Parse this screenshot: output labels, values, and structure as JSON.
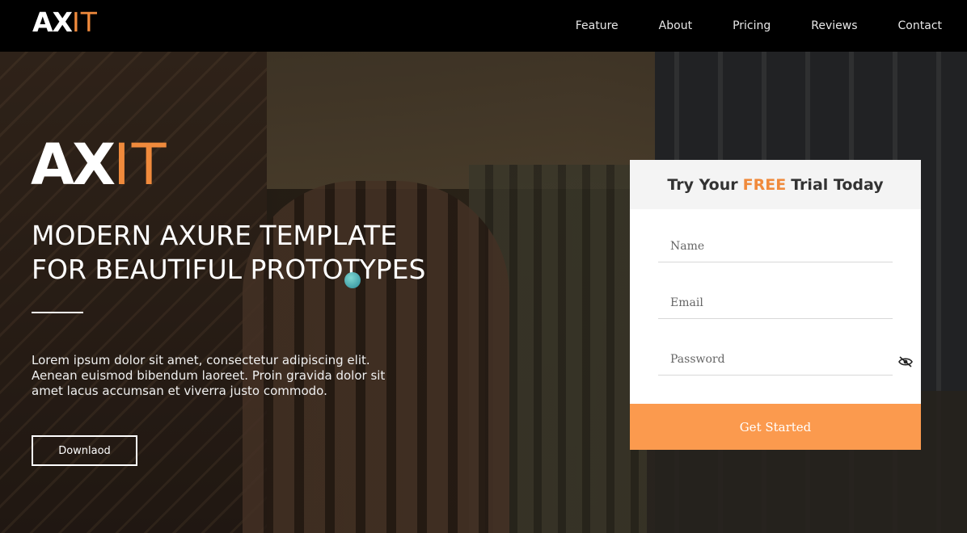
{
  "brand": {
    "ax": "AX",
    "it": "IT",
    "accent_color": "#f08a3c"
  },
  "nav": {
    "items": [
      {
        "label": "Feature"
      },
      {
        "label": "About"
      },
      {
        "label": "Pricing"
      },
      {
        "label": "Reviews"
      },
      {
        "label": "Contact"
      }
    ]
  },
  "hero": {
    "headline_line1": "MODERN AXURE TEMPLATE",
    "headline_line2": "FOR BEAUTIFUL PROTOTYPES",
    "description": "Lorem ipsum dolor sit amet, consectetur adipiscing elit. Aenean euismod bibendum laoreet. Proin gravida dolor sit amet lacus accumsan et viverra justo commodo.",
    "download_label": "Downlaod"
  },
  "trial_form": {
    "title_prefix": "Try Your",
    "title_highlight": "FREE",
    "title_suffix": "Trial Today",
    "name_placeholder": "Name",
    "email_placeholder": "Email",
    "password_placeholder": "Password",
    "password_toggle_icon": "eye-off-icon",
    "submit_label": "Get Started",
    "submit_color": "#fb9a4e"
  }
}
